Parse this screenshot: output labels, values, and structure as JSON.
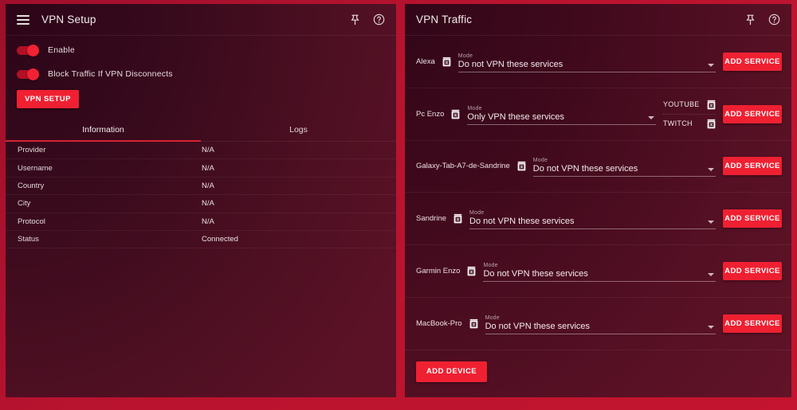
{
  "left_panel": {
    "title": "VPN Setup",
    "menu_icon": "hamburger-icon",
    "pin_icon": "pin-icon",
    "help_icon": "help-circle-icon",
    "toggles": [
      {
        "label": "Enable",
        "on": true
      },
      {
        "label": "Block Traffic If VPN Disconnects",
        "on": true
      }
    ],
    "setup_button": "VPN SETUP",
    "tabs": [
      {
        "label": "Information",
        "active": true
      },
      {
        "label": "Logs",
        "active": false
      }
    ],
    "info_rows": [
      {
        "key": "Provider",
        "value": "N/A"
      },
      {
        "key": "Username",
        "value": "N/A"
      },
      {
        "key": "Country",
        "value": "N/A"
      },
      {
        "key": "City",
        "value": "N/A"
      },
      {
        "key": "Protocol",
        "value": "N/A"
      },
      {
        "key": "Status",
        "value": "Connected"
      }
    ]
  },
  "right_panel": {
    "title": "VPN Traffic",
    "pin_icon": "pin-icon",
    "help_icon": "help-circle-icon",
    "mode_label": "Mode",
    "add_service_label": "ADD SERVICE",
    "add_device_label": "ADD DEVICE",
    "devices": [
      {
        "name": "Alexa",
        "mode": "Do not VPN these services",
        "services": []
      },
      {
        "name": "Pc Enzo",
        "mode": "Only VPN these services",
        "services": [
          "YOUTUBE",
          "TWITCH"
        ]
      },
      {
        "name": "Galaxy-Tab-A7-de-Sandrine",
        "mode": "Do not VPN these services",
        "services": []
      },
      {
        "name": "Sandrine",
        "mode": "Do not VPN these services",
        "services": []
      },
      {
        "name": "Garmin Enzo",
        "mode": "Do not VPN these services",
        "services": []
      },
      {
        "name": "MacBook-Pro",
        "mode": "Do not VPN these services",
        "services": []
      }
    ]
  },
  "colors": {
    "accent_red": "#ef2031",
    "page_background": "#b8132f",
    "panel_dark": "#370a1c",
    "tab_underline": "#d41b2c"
  }
}
